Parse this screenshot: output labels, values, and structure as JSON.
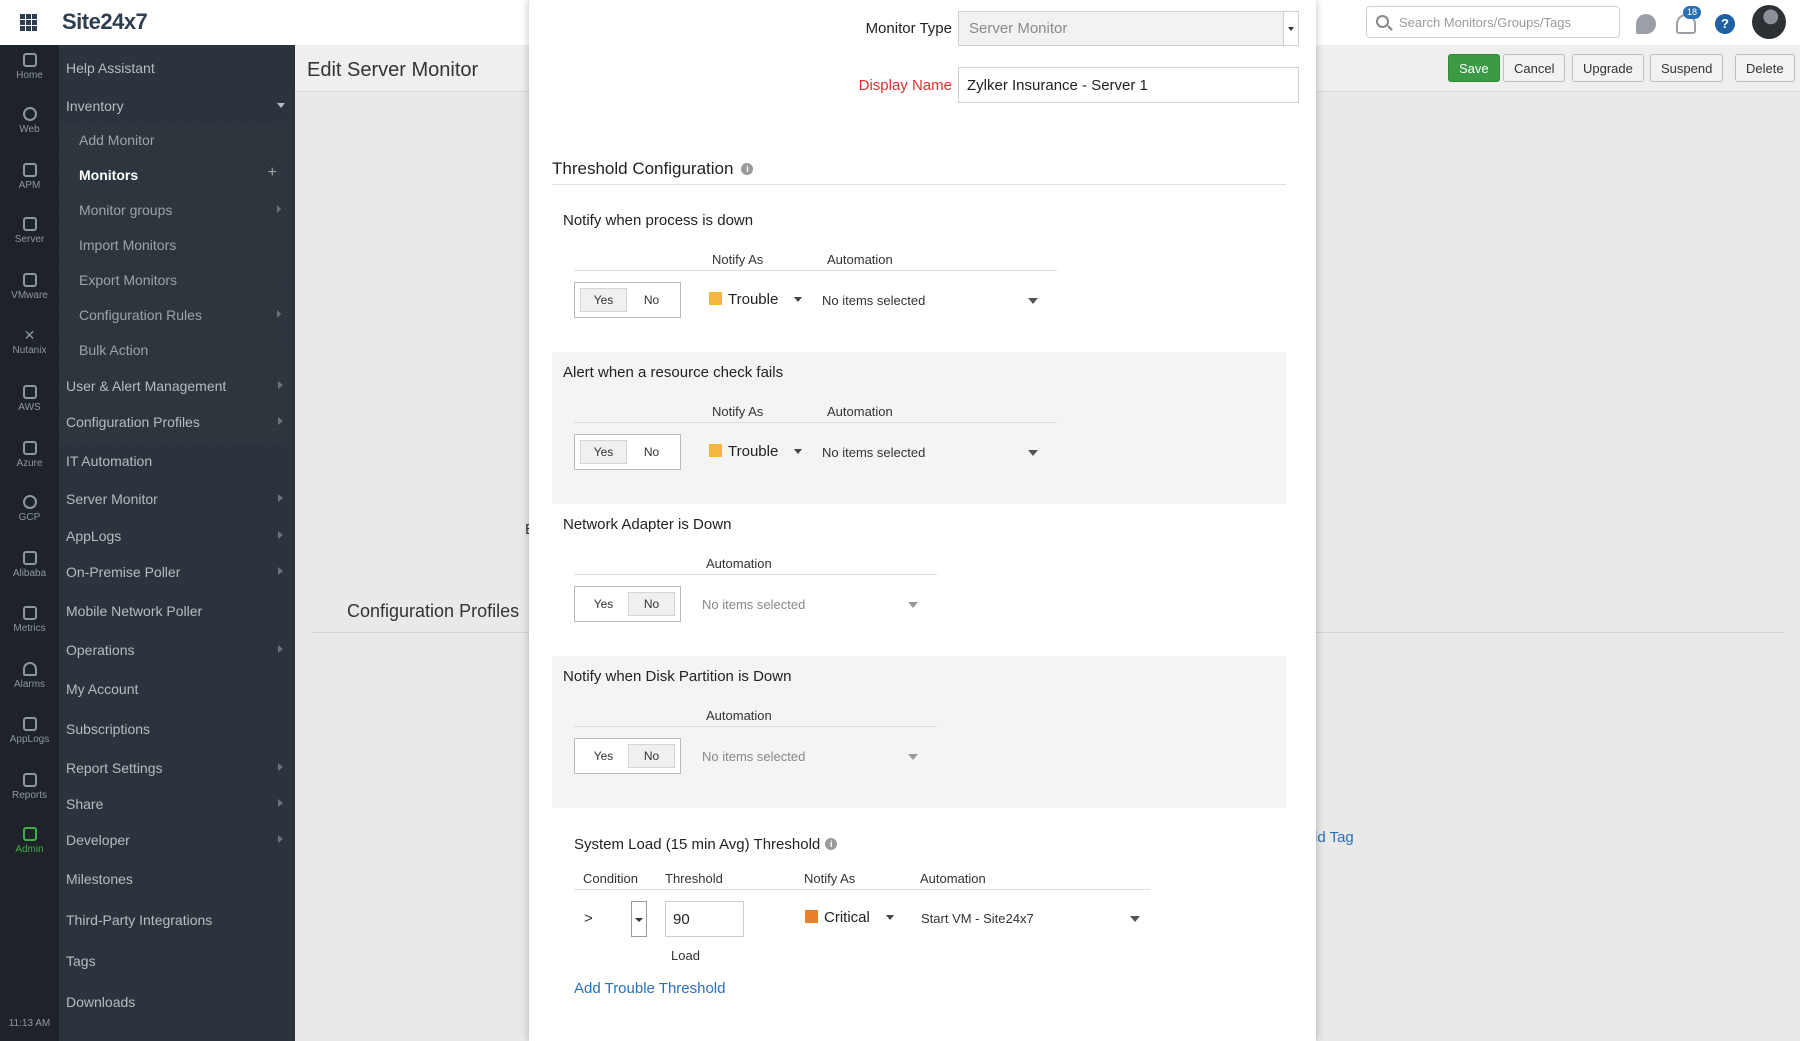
{
  "topbar": {
    "logo": "Site24x7",
    "search_placeholder": "Search Monitors/Groups/Tags",
    "notification_count": "18",
    "help_label": "?"
  },
  "rail": {
    "items": [
      "Home",
      "Web",
      "APM",
      "Server",
      "VMware",
      "Nutanix",
      "AWS",
      "Azure",
      "GCP",
      "Alibaba",
      "Metrics",
      "Alarms",
      "AppLogs",
      "Reports",
      "Admin"
    ],
    "active": "Admin",
    "time": "11:13 AM"
  },
  "menu": {
    "help_assistant": "Help Assistant",
    "inventory": "Inventory",
    "inventory_items": [
      "Add Monitor",
      "Monitors",
      "Monitor groups",
      "Import Monitors",
      "Export Monitors",
      "Configuration Rules",
      "Bulk Action"
    ],
    "active_inventory_item": "Monitors",
    "items": [
      "User & Alert Management",
      "Configuration Profiles",
      "IT Automation",
      "Server Monitor",
      "AppLogs",
      "On-Premise Poller",
      "Mobile Network Poller",
      "Operations",
      "My Account",
      "Subscriptions",
      "Report Settings",
      "Share",
      "Developer",
      "Milestones",
      "Third-Party Integrations",
      "Tags",
      "Downloads"
    ]
  },
  "background_page": {
    "title": "Edit Server Monitor",
    "buttons": {
      "save": "Save",
      "cancel": "Cancel",
      "upgrade": "Upgrade",
      "suspend": "Suspend",
      "delete": "Delete"
    },
    "config_profiles_title": "Configuration Profiles",
    "add_tag_fragment": "dd Tag",
    "edge_fragment": "E"
  },
  "modal": {
    "monitor_type_label": "Monitor Type",
    "monitor_type_value": "Server Monitor",
    "display_name_label": "Display Name",
    "display_name_value": "Zylker Insurance - Server 1",
    "section_title": "Threshold Configuration",
    "info_glyph": "i",
    "col_notify_as": "Notify As",
    "col_automation": "Automation",
    "yes": "Yes",
    "no": "No",
    "blocks": [
      {
        "title": "Notify when process is down",
        "toggle": "Yes",
        "notify_as": "Trouble",
        "automation": "No items selected"
      },
      {
        "title": "Alert when a resource check fails",
        "toggle": "Yes",
        "notify_as": "Trouble",
        "automation": "No items selected"
      },
      {
        "title": "Network Adapter is Down",
        "toggle": "No",
        "automation": "No items selected"
      },
      {
        "title": "Notify when Disk Partition is Down",
        "toggle": "No",
        "automation": "No items selected"
      }
    ],
    "threshold": {
      "title": "System Load (15 min Avg) Threshold",
      "col_condition": "Condition",
      "col_threshold": "Threshold",
      "col_notify_as": "Notify As",
      "col_automation": "Automation",
      "condition": ">",
      "value": "90",
      "unit": "Load",
      "notify_as": "Critical",
      "automation": "Start VM - Site24x7",
      "add_link": "Add Trouble Threshold"
    }
  },
  "colors": {
    "trouble": "#f4b63e",
    "critical": "#e8822a",
    "save_button": "#3b9b45",
    "link": "#2a6fb4",
    "required_label": "#e03131",
    "active_rail": "#3fae49"
  }
}
